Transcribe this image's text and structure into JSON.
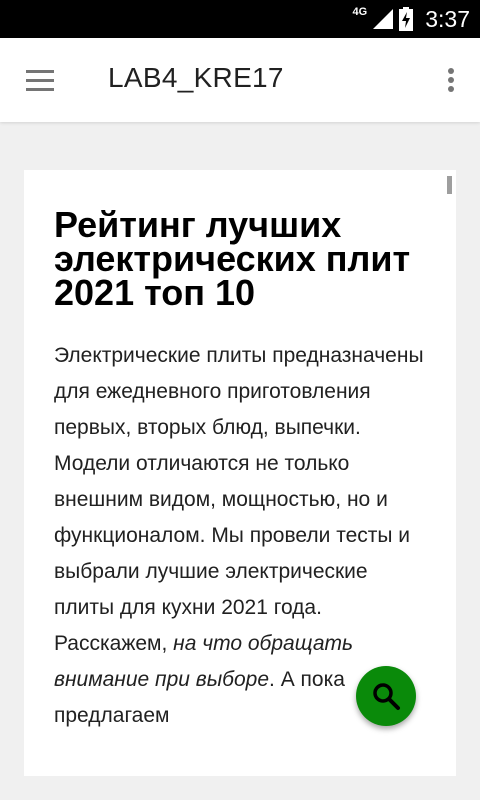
{
  "status_bar": {
    "network": "4G",
    "time": "3:37"
  },
  "app_bar": {
    "title": "LAB4_KRE17",
    "menu_icon": "hamburger-menu-icon",
    "overflow_icon": "more-vert-icon"
  },
  "article": {
    "title": "Рейтинг лучших электрических плит 2021 топ 10",
    "body_intro": "Электрические плиты предназначены для ежедневного приготовления первых, вторых блюд, выпечки. Модели отличаются не только внешним видом, мощностью, но и функционалом. Мы провели тесты и выбрали лучшие электрические плиты для кухни 2021 года. Расскажем, ",
    "body_emphasis": "на что обращать внимание при выборе",
    "body_after": ". А пока предлагаем"
  },
  "fab": {
    "icon": "search-icon",
    "color": "#0a8a0a"
  }
}
